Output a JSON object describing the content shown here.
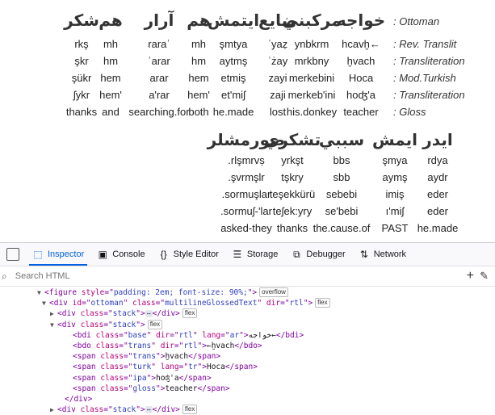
{
  "rows": [
    {
      "type": "ar",
      "label": ": Ottoman",
      "cells": [
        "شكر",
        "هم",
        "آرار",
        "هم",
        "ايتمش",
        "ضايع",
        "مركبني",
        "خواجه"
      ]
    },
    {
      "type": "t",
      "label": ": Rev. Translit",
      "cells": [
        "rkş",
        "mh",
        "raraʾ",
        "mh",
        "şmtya",
        "ʿyaẓ",
        "ynbkrm",
        "hcavḫ←"
      ]
    },
    {
      "type": "t",
      "label": ": Transliteration",
      "cells": [
        "şkr",
        "hm",
        "ʾarar",
        "hm",
        "aytmş",
        "ʾżay",
        "mrkbny",
        "ḫvach"
      ]
    },
    {
      "type": "t",
      "label": ": Mod.Turkish",
      "cells": [
        "şükr",
        "hem",
        "arar",
        "hem",
        "etmiş",
        "zayi",
        "merkebini",
        "Hoca"
      ]
    },
    {
      "type": "t",
      "label": ": Transliteration",
      "cells": [
        "ʃykr",
        "hem'",
        "a'rar",
        "hem'",
        "et'miʃ",
        "zaji",
        "merkeb'ini",
        "hoʤ'a"
      ]
    },
    {
      "type": "t",
      "label": ": Gloss",
      "cells": [
        "thanks",
        "and",
        "searching.for",
        "both",
        "he.made",
        "lost",
        "his.donkey",
        "teacher"
      ]
    }
  ],
  "rows2": [
    {
      "type": "ar",
      "cells": [
        "صورمشلر",
        "تشكري",
        "سببي",
        "ايمش",
        "ايدر"
      ]
    },
    {
      "type": "t",
      "cells": [
        ".rlşmrvṣ",
        "yrkşt",
        "bbs",
        "şmya",
        "rdya"
      ]
    },
    {
      "type": "t",
      "cells": [
        ".şvrmşlr",
        "tşkry",
        "sbb",
        "aymş",
        "aydr"
      ]
    },
    {
      "type": "t",
      "cells": [
        ".sormuşlar",
        "teşekkürü",
        "sebebi",
        "imiş",
        "eder"
      ]
    },
    {
      "type": "t",
      "cells": [
        ".sormuʃ-'lar",
        "teʃek:yry",
        "se'bebi",
        "ı'miʃ",
        "eder"
      ]
    },
    {
      "type": "t",
      "cells": [
        "asked-they",
        "thanks",
        "the.cause.of",
        "PAST",
        "he.made"
      ]
    }
  ],
  "devtools": {
    "tabs": [
      {
        "icon": "⬚",
        "label": "Inspector"
      },
      {
        "icon": "▣",
        "label": "Console"
      },
      {
        "icon": "{}",
        "label": "Style Editor"
      },
      {
        "icon": "☰",
        "label": "Storage"
      },
      {
        "icon": "⧉",
        "label": "Debugger"
      },
      {
        "icon": "⇅",
        "label": "Network"
      }
    ],
    "search_placeholder": "Search HTML",
    "tree": [
      {
        "indent": 56,
        "tri": "▼",
        "parts": [
          [
            "tg",
            "<figure "
          ],
          [
            "at",
            "style"
          ],
          [
            "tg",
            "=\""
          ],
          [
            "av",
            "padding: 2em; font-size: 90%;"
          ],
          [
            "tg",
            "\">"
          ]
        ],
        "badge": "overflow"
      },
      {
        "indent": 62,
        "tri": "▼",
        "parts": [
          [
            "tg",
            "<div "
          ],
          [
            "at",
            "id"
          ],
          [
            "tg",
            "=\""
          ],
          [
            "av",
            "ottoman"
          ],
          [
            "tg",
            "\" "
          ],
          [
            "at",
            "class"
          ],
          [
            "tg",
            "=\""
          ],
          [
            "av",
            "multilineGlossedText"
          ],
          [
            "tg",
            "\" "
          ],
          [
            "at",
            "dir"
          ],
          [
            "tg",
            "=\""
          ],
          [
            "av",
            "rtl"
          ],
          [
            "tg",
            "\">"
          ]
        ],
        "badge": "flex"
      },
      {
        "indent": 72,
        "tri": "▶",
        "parts": [
          [
            "tg",
            "<div "
          ],
          [
            "at",
            "class"
          ],
          [
            "tg",
            "=\""
          ],
          [
            "av",
            "stack"
          ],
          [
            "tg",
            "\">"
          ]
        ],
        "ell": true,
        "after": [
          [
            "tg",
            "</div>"
          ]
        ],
        "badge": "flex"
      },
      {
        "indent": 72,
        "tri": "▼",
        "parts": [
          [
            "tg",
            "<div "
          ],
          [
            "at",
            "class"
          ],
          [
            "tg",
            "=\""
          ],
          [
            "av",
            "stack"
          ],
          [
            "tg",
            "\">"
          ]
        ],
        "badge": "flex"
      },
      {
        "indent": 90,
        "tri": "",
        "parts": [
          [
            "tg",
            "<bdi "
          ],
          [
            "at",
            "class"
          ],
          [
            "tg",
            "=\""
          ],
          [
            "av",
            "base"
          ],
          [
            "tg",
            "\" "
          ],
          [
            "at",
            "dir"
          ],
          [
            "tg",
            "=\""
          ],
          [
            "av",
            "rtl"
          ],
          [
            "tg",
            "\" "
          ],
          [
            "at",
            "lang"
          ],
          [
            "tg",
            "=\""
          ],
          [
            "av",
            "ar"
          ],
          [
            "tg",
            "\">"
          ],
          [
            "tx",
            "خواجه←"
          ],
          [
            "tg",
            "</bdi>"
          ]
        ]
      },
      {
        "indent": 90,
        "tri": "",
        "parts": [
          [
            "tg",
            "<bdo "
          ],
          [
            "at",
            "class"
          ],
          [
            "tg",
            "=\""
          ],
          [
            "av",
            "trans"
          ],
          [
            "tg",
            "\" "
          ],
          [
            "at",
            "dir"
          ],
          [
            "tg",
            "=\""
          ],
          [
            "av",
            "rtl"
          ],
          [
            "tg",
            "\">"
          ],
          [
            "tx",
            "←ḫvach"
          ],
          [
            "tg",
            "</bdo>"
          ]
        ]
      },
      {
        "indent": 90,
        "tri": "",
        "parts": [
          [
            "tg",
            "<span "
          ],
          [
            "at",
            "class"
          ],
          [
            "tg",
            "=\""
          ],
          [
            "av",
            "trans"
          ],
          [
            "tg",
            "\">"
          ],
          [
            "tx",
            "ḫvach"
          ],
          [
            "tg",
            "</span>"
          ]
        ]
      },
      {
        "indent": 90,
        "tri": "",
        "parts": [
          [
            "tg",
            "<span "
          ],
          [
            "at",
            "class"
          ],
          [
            "tg",
            "=\""
          ],
          [
            "av",
            "turk"
          ],
          [
            "tg",
            "\" "
          ],
          [
            "at",
            "lang"
          ],
          [
            "tg",
            "=\""
          ],
          [
            "av",
            "tr"
          ],
          [
            "tg",
            "\">"
          ],
          [
            "tx",
            "Hoca"
          ],
          [
            "tg",
            "</span>"
          ]
        ]
      },
      {
        "indent": 90,
        "tri": "",
        "parts": [
          [
            "tg",
            "<span "
          ],
          [
            "at",
            "class"
          ],
          [
            "tg",
            "=\""
          ],
          [
            "av",
            "ipa"
          ],
          [
            "tg",
            "\">"
          ],
          [
            "tx",
            "hoʤ'a"
          ],
          [
            "tg",
            "</span>"
          ]
        ]
      },
      {
        "indent": 90,
        "tri": "",
        "parts": [
          [
            "tg",
            "<span "
          ],
          [
            "at",
            "class"
          ],
          [
            "tg",
            "=\""
          ],
          [
            "av",
            "gloss"
          ],
          [
            "tg",
            "\">"
          ],
          [
            "tx",
            "teacher"
          ],
          [
            "tg",
            "</span>"
          ]
        ]
      },
      {
        "indent": 80,
        "tri": "",
        "parts": [
          [
            "tg",
            "</div>"
          ]
        ]
      },
      {
        "indent": 72,
        "tri": "▶",
        "parts": [
          [
            "tg",
            "<div "
          ],
          [
            "at",
            "class"
          ],
          [
            "tg",
            "=\""
          ],
          [
            "av",
            "stack"
          ],
          [
            "tg",
            "\">"
          ]
        ],
        "ell": true,
        "after": [
          [
            "tg",
            "</div>"
          ]
        ],
        "badge": "flex"
      }
    ]
  }
}
